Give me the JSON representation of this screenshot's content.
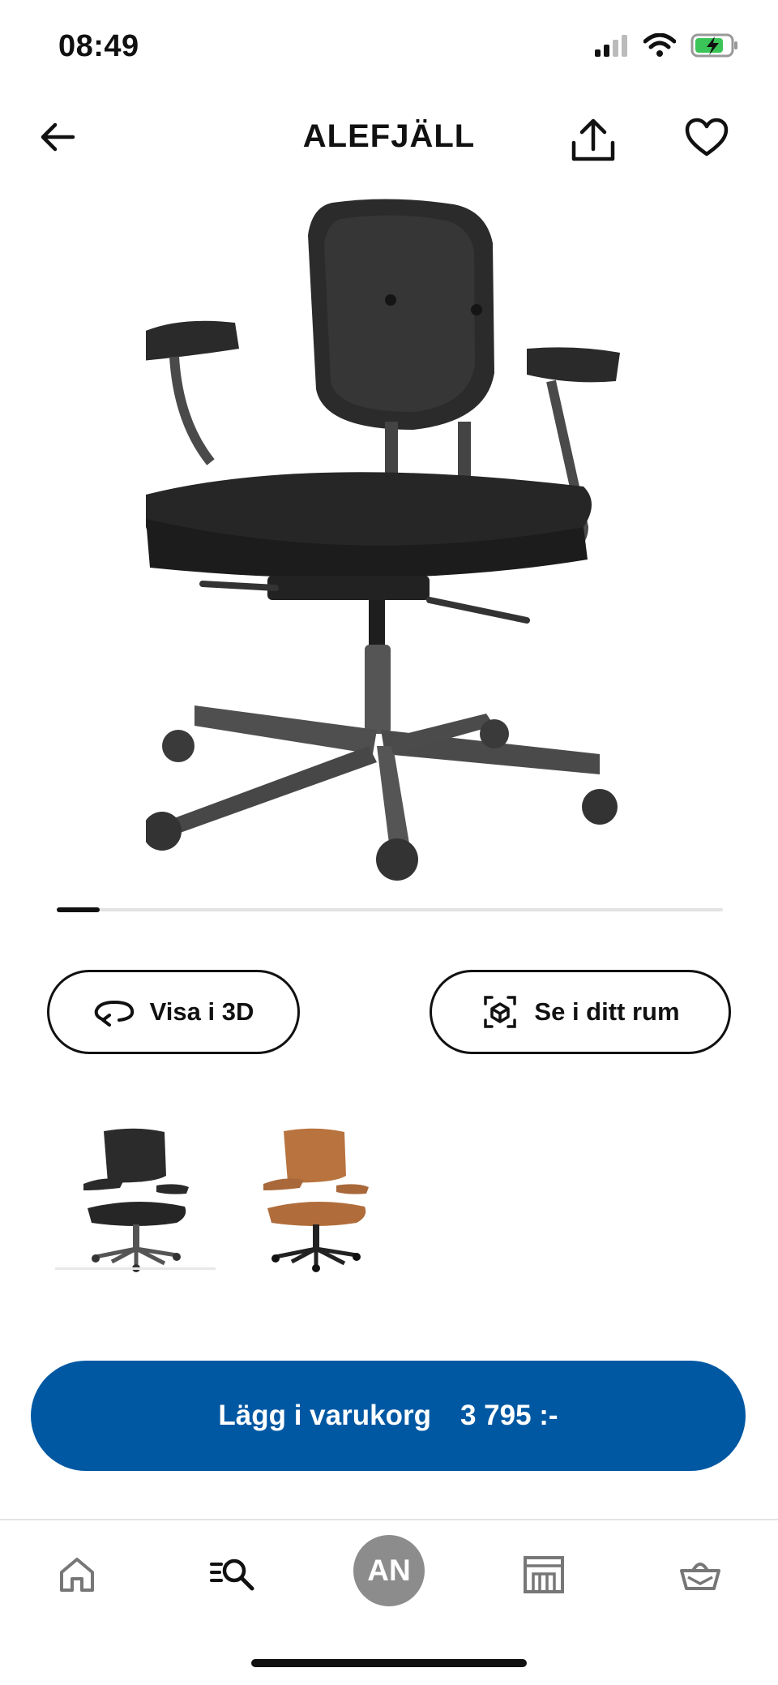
{
  "status_bar": {
    "time": "08:49",
    "icons": [
      "signal-icon",
      "wifi-icon",
      "battery-charging-icon"
    ]
  },
  "header": {
    "title": "ALEFJÄLL",
    "back_icon": "arrow-left-icon",
    "share_icon": "share-icon",
    "favorite_icon": "heart-icon"
  },
  "gallery": {
    "image": "office-chair-black-leather",
    "progress_fraction": 0.065
  },
  "actions": {
    "view_3d_label": "Visa i 3D",
    "view_in_room_label": "Se i ditt rum"
  },
  "variants": {
    "items": [
      {
        "color": "black",
        "selected": true
      },
      {
        "color": "tan",
        "selected": false
      }
    ]
  },
  "cart": {
    "label": "Lägg i varukorg",
    "price": "3 795 :-",
    "background": "#0058a3"
  },
  "bottom_nav": {
    "items": [
      "home-icon",
      "search-icon",
      "avatar",
      "store-icon",
      "basket-icon"
    ],
    "avatar_initials": "AN"
  },
  "colors": {
    "accent": "#0058a3",
    "avatar_bg": "#8c8c8c"
  }
}
